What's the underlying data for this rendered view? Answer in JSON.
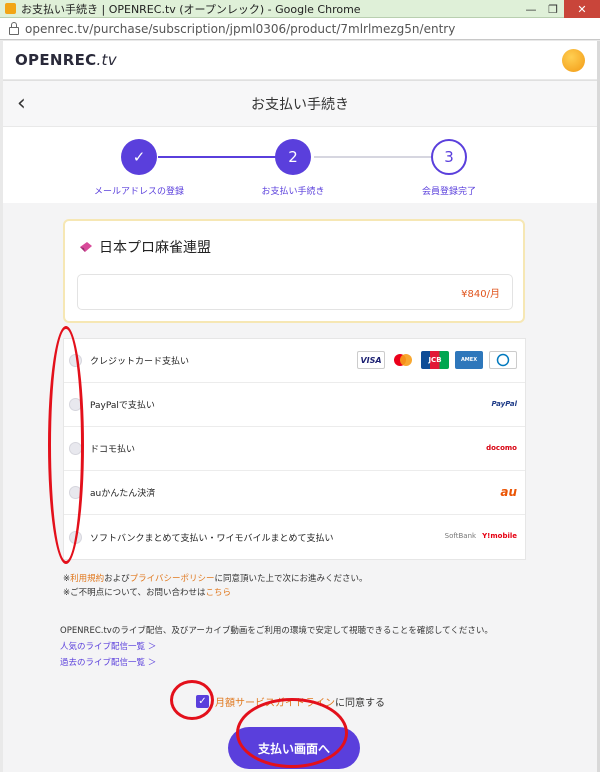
{
  "window": {
    "title": "お支払い手続き | OPENREC.tv (オープンレック) - Google Chrome",
    "url": "openrec.tv/purchase/subscription/jpml0306/product/7mlrlmezg5n/entry"
  },
  "header": {
    "logo_main": "OPENREC",
    "logo_suffix": ".tv",
    "page_title": "お支払い手続き",
    "back_label": "‹"
  },
  "steps": [
    {
      "label": "メールアドレスの登録",
      "mark": "✓"
    },
    {
      "label": "お支払い手続き",
      "mark": "2"
    },
    {
      "label": "会員登録完了",
      "mark": "3"
    }
  ],
  "product": {
    "name": "日本プロ麻雀連盟",
    "price": "¥840/月"
  },
  "payments": [
    {
      "label": "クレジットカード支払い",
      "brands": [
        "VISA",
        "MC",
        "JCB",
        "AMEX",
        "DINERS"
      ]
    },
    {
      "label": "PayPalで支払い",
      "brand_text": "PayPal"
    },
    {
      "label": "ドコモ払い",
      "brand_text": "docomo"
    },
    {
      "label": "auかんたん決済",
      "brand_text": "au"
    },
    {
      "label": "ソフトバンクまとめて支払い・ワイモバイルまとめて支払い",
      "brand_text_1": "SoftBank",
      "brand_text_2": "Y!mobile"
    }
  ],
  "notes": {
    "line1_prefix": "※",
    "line1_link1": "利用規約",
    "line1_mid": "および",
    "line1_link2": "プライバシーポリシー",
    "line1_suffix": "に同意頂いた上で次にお進みください。",
    "line2_prefix": "※ご不明点について、お問い合わせは",
    "line2_link": "こちら"
  },
  "info": {
    "text": "OPENREC.tvのライブ配信、及びアーカイブ動画をご利用の環境で安定して視聴できることを確認してください。",
    "link1": "人気のライブ配信一覧 ＞",
    "link2": "過去のライブ配信一覧 ＞"
  },
  "agreement": {
    "link": "月額サービスガイドライン",
    "suffix": "に同意する",
    "check": "✓"
  },
  "cta": {
    "label": "支払い画面へ"
  },
  "colors": {
    "accent": "#5a3fdc",
    "link_orange": "#e0781e",
    "annotation_red": "#e3101b"
  }
}
